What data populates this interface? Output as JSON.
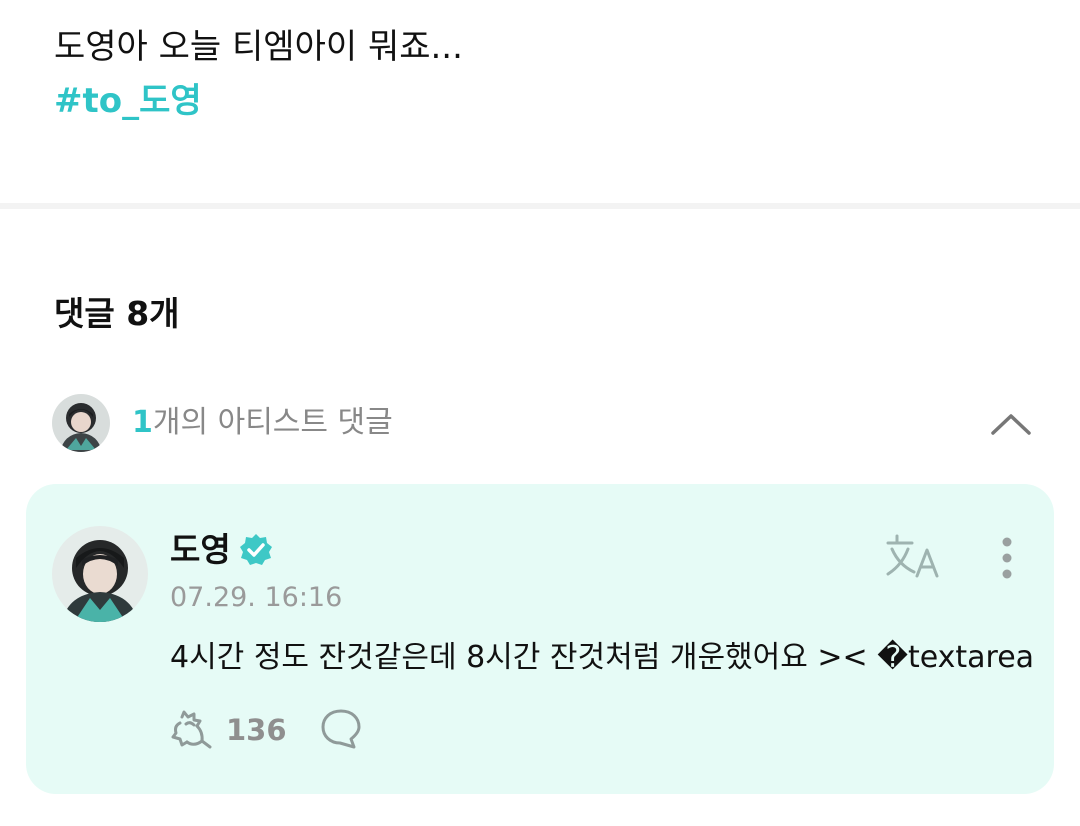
{
  "post": {
    "text": "도영아 오늘 티엠아이 뭐죠...",
    "hashtag": "#to_도영"
  },
  "comments": {
    "title": "댓글 8개",
    "artist_summary": {
      "count": "1",
      "label": "개의 아티스트 댓글"
    },
    "items": [
      {
        "author": "도영",
        "timestamp": "07.29. 16:16",
        "body": "4시간 정도 잔것같은데 8시간 잔것처럼 개운했어요 >< �textarea",
        "likes": "136"
      }
    ]
  },
  "colors": {
    "accent": "#2fc4c7",
    "card_background": "#e6fbf6",
    "muted_text": "#888888"
  },
  "icons": {
    "collapse": "chevron-up-icon",
    "verified": "verified-badge-icon",
    "translate": "translate-icon",
    "more": "more-vertical-icon",
    "like": "like-icon",
    "reply": "reply-icon"
  }
}
